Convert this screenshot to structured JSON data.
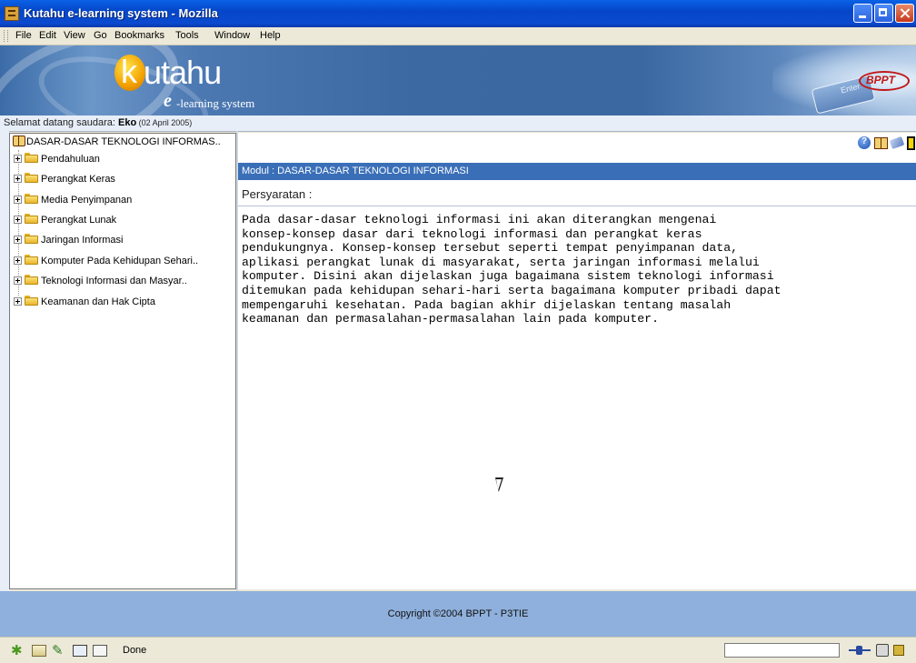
{
  "window": {
    "title": "Kutahu e-learning system - Mozilla"
  },
  "menu": [
    "File",
    "Edit",
    "View",
    "Go",
    "Bookmarks",
    "Tools",
    "Window",
    "Help"
  ],
  "banner": {
    "logo_k": "k",
    "logo_word": "utahu",
    "logo_e": "e",
    "logo_sub": "-learning system",
    "enter_key_label": "Enter",
    "partner_logo": "BPPT"
  },
  "welcome": {
    "label": "Selamat datang saudara: ",
    "name": "Eko",
    "date": " (02 April 2005)"
  },
  "tree": {
    "root": "DASAR-DASAR TEKNOLOGI INFORMAS..",
    "items": [
      "Pendahuluan",
      "Perangkat Keras",
      "Media Penyimpanan",
      "Perangkat Lunak",
      "Jaringan Informasi",
      "Komputer Pada Kehidupan Sehari..",
      "Teknologi Informasi dan Masyar..",
      "Keamanan dan Hak Cipta"
    ]
  },
  "content": {
    "module_title": "Modul : DASAR-DASAR TEKNOLOGI INFORMASI",
    "requirements_label": "Persyaratan :",
    "description": "Pada dasar-dasar teknologi informasi ini akan diterangkan mengenai\nkonsep-konsep dasar dari teknologi informasi dan perangkat keras\npendukungnya. Konsep-konsep tersebut seperti tempat penyimpanan data,\naplikasi perangkat lunak di masyarakat, serta jaringan informasi melalui\nkomputer. Disini akan dijelaskan juga bagaimana sistem teknologi informasi\nditemukan pada kehidupan sehari-hari serta bagaimana komputer pribadi dapat\nmempengaruhi kesehatan. Pada bagian akhir dijelaskan tentang masalah\nkeamanan dan permasalahan-permasalahan lain pada komputer."
  },
  "toolbar_icons": [
    "help-icon",
    "book-icon",
    "mail-icon",
    "exit-door-icon"
  ],
  "footer": {
    "copyright": "Copyright ©2004 BPPT - P3TIE"
  },
  "status": {
    "text": "Done",
    "icons": [
      "navigator-icon",
      "mail-icon",
      "composer-icon",
      "address-book-icon",
      "irc-chat-icon",
      "online-status-icon",
      "security-icon",
      "lock-icon"
    ]
  },
  "colors": {
    "titlebar": "#0546c8",
    "module_bar": "#3a6fb8",
    "footer": "#8fb0dc",
    "banner": "#3d69a3"
  }
}
